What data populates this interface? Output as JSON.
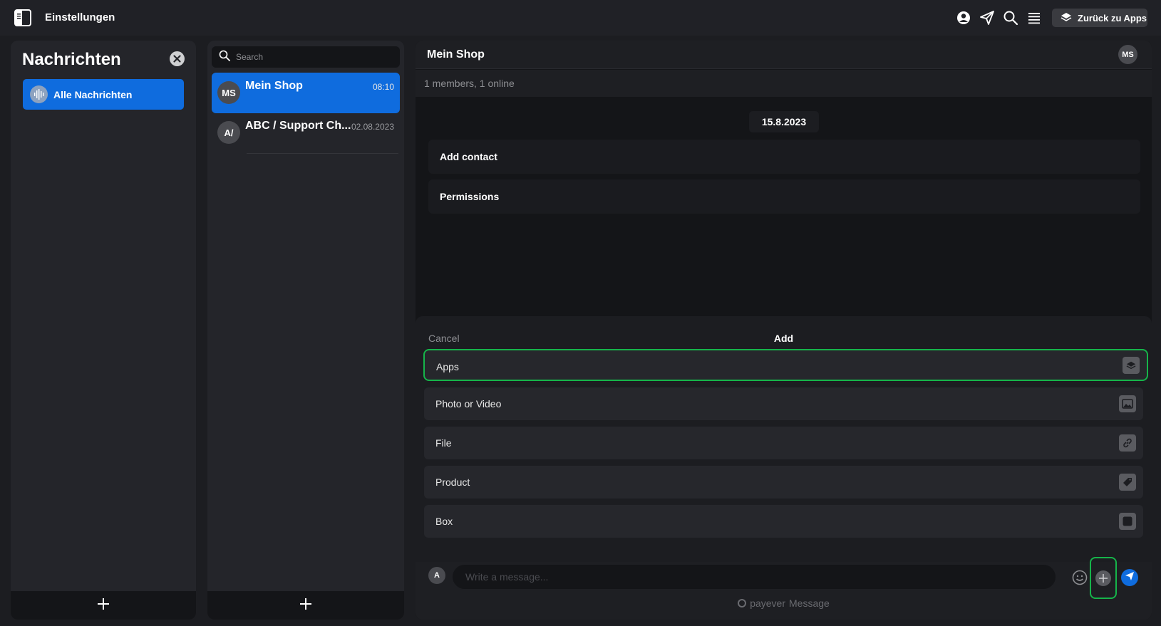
{
  "topbar": {
    "title": "Einstellungen",
    "back_label": "Zurück zu Apps",
    "icons": [
      "sidebar-toggle-icon",
      "user-icon",
      "send-icon",
      "search-icon",
      "menu-icon",
      "layers-icon"
    ]
  },
  "folders": {
    "title": "Nachrichten",
    "items": [
      {
        "label": "Alle Nachrichten",
        "icon": "soundwave-icon",
        "active": true
      }
    ]
  },
  "chat_list": {
    "search_placeholder": "Search",
    "chats": [
      {
        "avatar": "MS",
        "name": "Mein Shop",
        "time": "08:10",
        "active": true
      },
      {
        "avatar": "A/",
        "name": "ABC / Support Ch...",
        "time": "02.08.2023",
        "active": false
      }
    ]
  },
  "conversation": {
    "title": "Mein Shop",
    "avatar": "MS",
    "members_text": "1 members, 1 online",
    "date": "15.8.2023",
    "messages": [
      {
        "label": "Add contact"
      },
      {
        "label": "Permissions"
      }
    ]
  },
  "add_sheet": {
    "cancel_label": "Cancel",
    "title": "Add",
    "options": [
      {
        "label": "Apps",
        "icon": "layers-icon",
        "highlighted": true
      },
      {
        "label": "Photo or Video",
        "icon": "image-icon",
        "highlighted": false
      },
      {
        "label": "File",
        "icon": "link-icon",
        "highlighted": false
      },
      {
        "label": "Product",
        "icon": "tag-icon",
        "highlighted": false
      },
      {
        "label": "Box",
        "icon": "box-icon",
        "highlighted": false
      }
    ]
  },
  "composer": {
    "avatar": "A",
    "placeholder": "Write a message...",
    "brand_name": "payever",
    "brand_suffix": "Message"
  },
  "colors": {
    "accent": "#0f6cde",
    "highlight": "#16b44a",
    "background": "#1c1d21"
  }
}
